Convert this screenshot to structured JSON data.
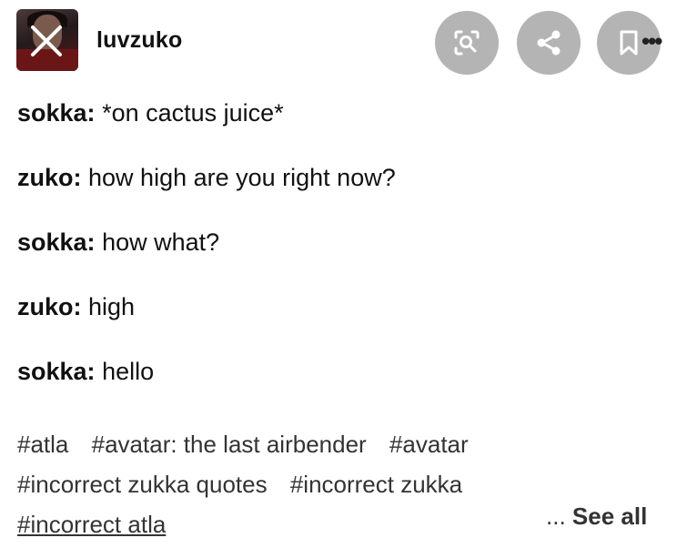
{
  "post": {
    "username": "luvzuko",
    "lines": [
      {
        "speaker": "sokka:",
        "text": "*on cactus juice*"
      },
      {
        "speaker": "zuko:",
        "text": "how high are you right now?"
      },
      {
        "speaker": "sokka:",
        "text": "how what?"
      },
      {
        "speaker": "zuko:",
        "text": "high"
      },
      {
        "speaker": "sokka:",
        "text": "hello"
      }
    ],
    "tags": [
      "#atla",
      "#avatar: the last airbender",
      "#avatar",
      "#incorrect zukka quotes",
      "#incorrect zukka",
      "#incorrect atla"
    ],
    "see_all_prefix": "...",
    "see_all_label": "See all"
  },
  "toolbar": {
    "lens_icon": "lens-search-icon",
    "share_icon": "share-icon",
    "save_icon": "bookmark-icon",
    "more_icon": "more-dots-icon",
    "button_color": "#b4b4b4"
  }
}
